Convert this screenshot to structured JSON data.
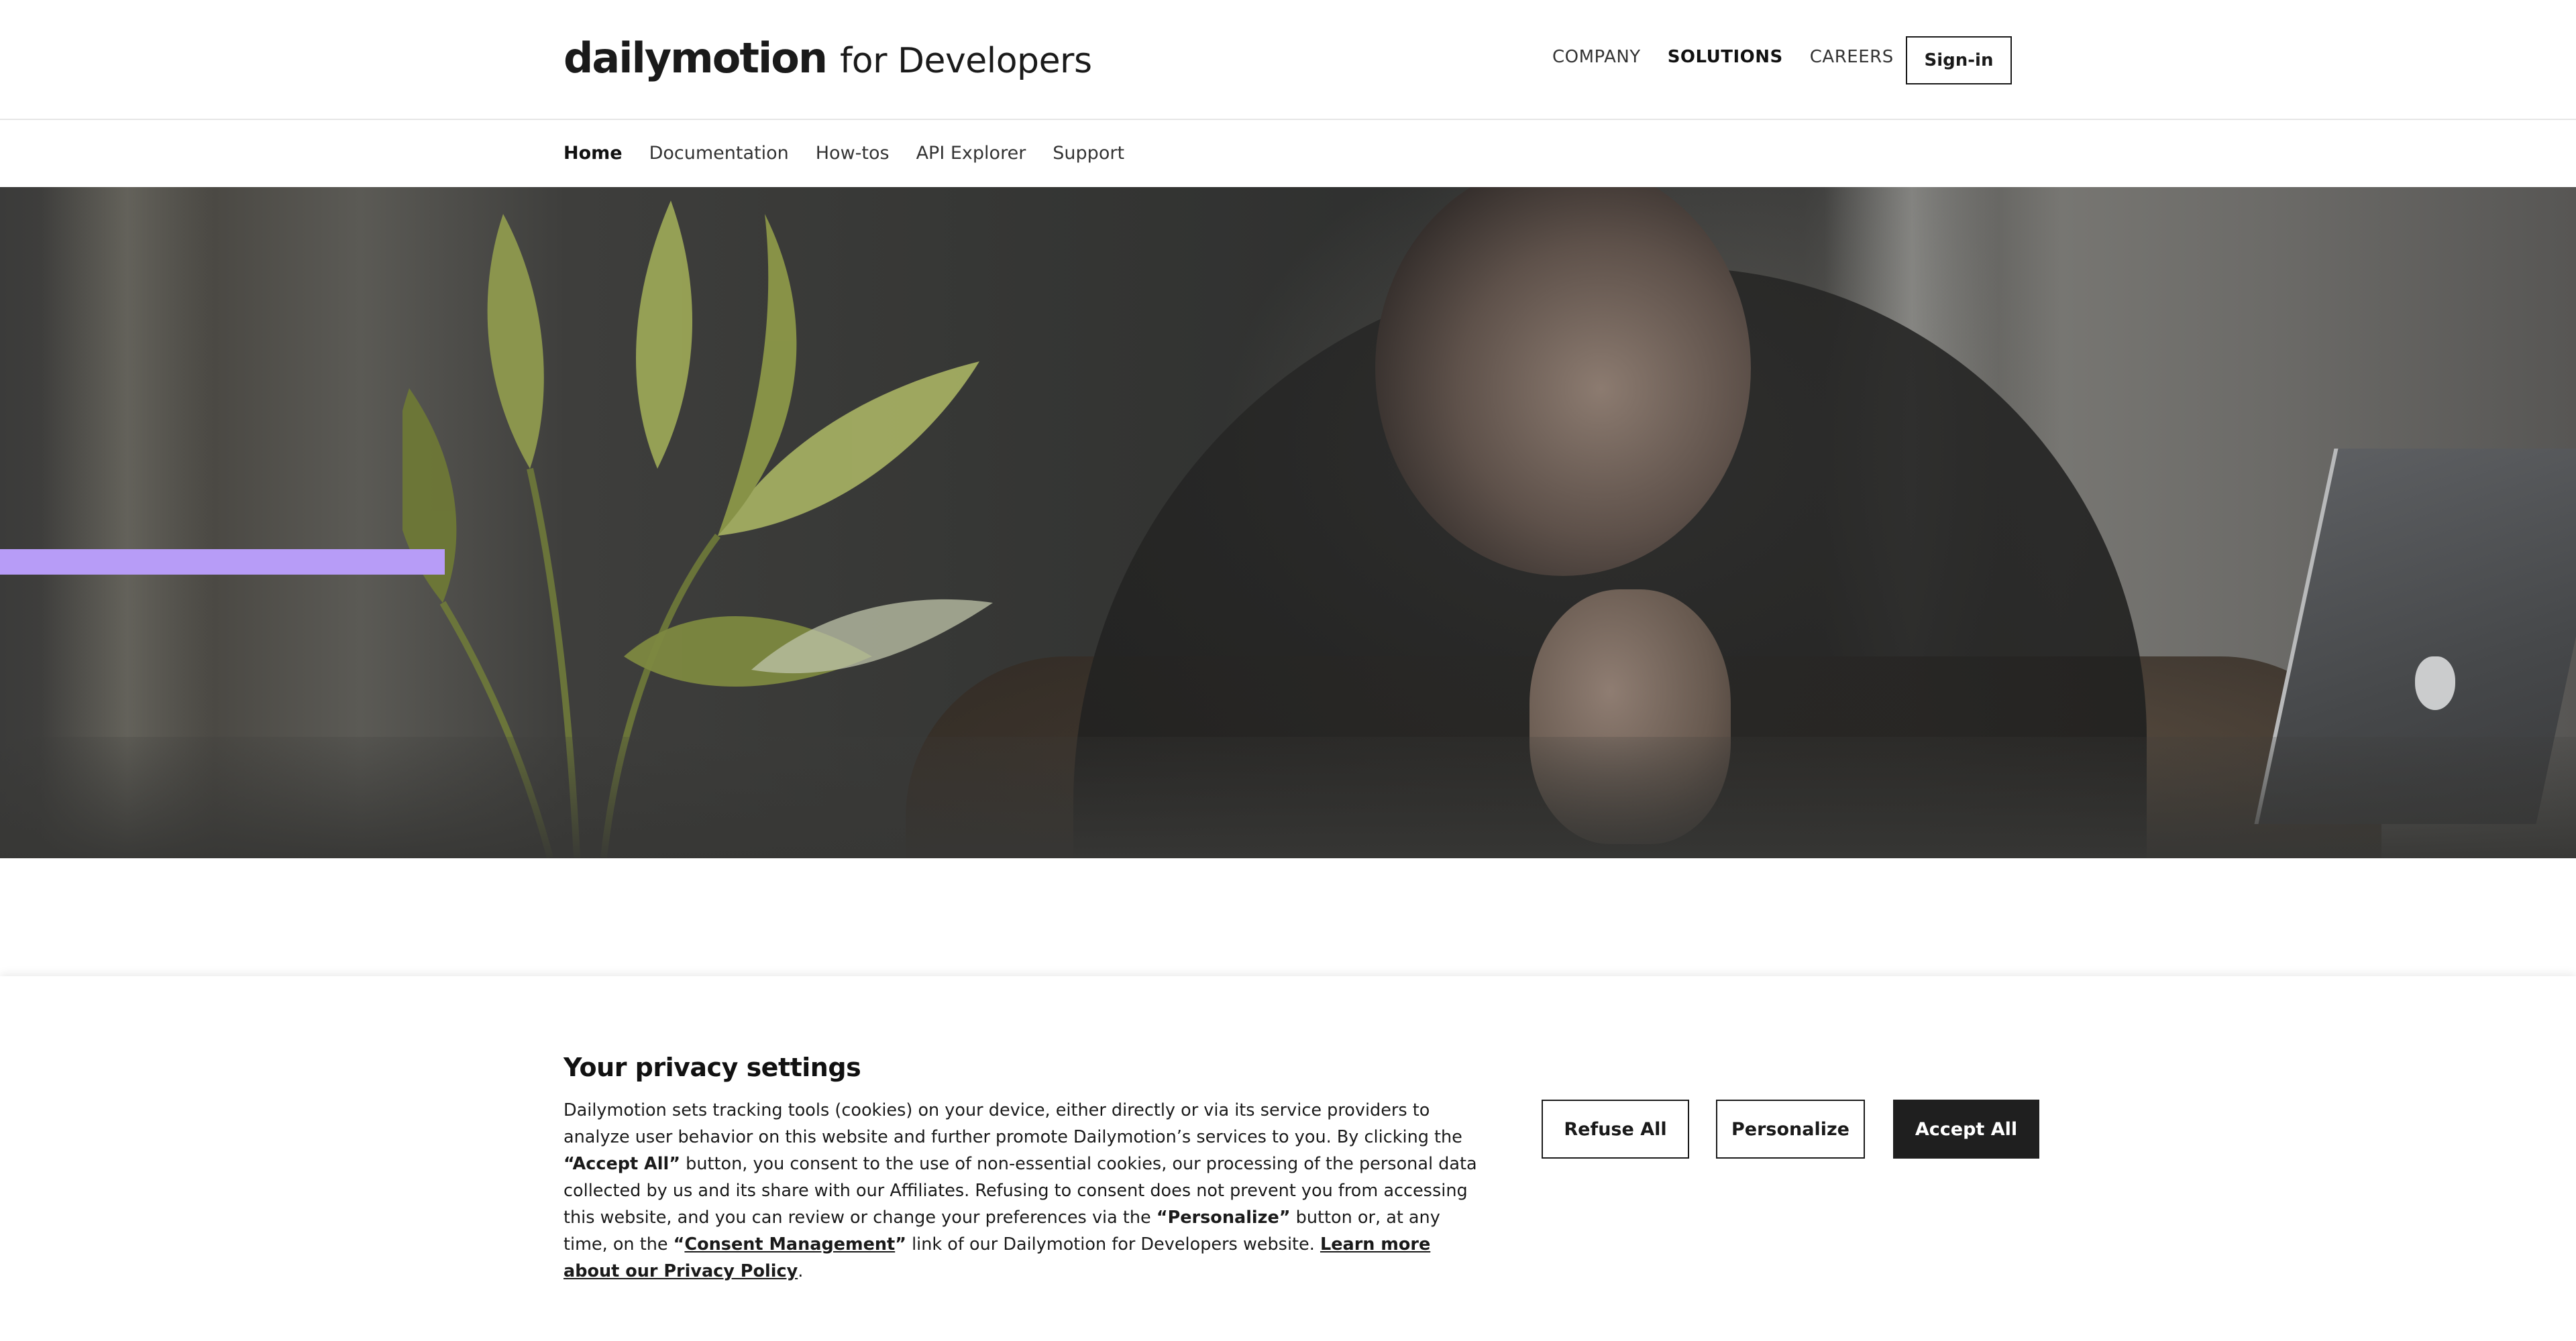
{
  "brand": {
    "logo_word": "dailymotion",
    "logo_sub": "for Developers"
  },
  "top_nav": {
    "items": [
      {
        "label": "COMPANY",
        "active": false
      },
      {
        "label": "SOLUTIONS",
        "active": true
      },
      {
        "label": "CAREERS",
        "active": false
      }
    ],
    "sign_in_label": "Sign-in"
  },
  "sub_nav": {
    "items": [
      {
        "label": "Home",
        "active": true
      },
      {
        "label": "Documentation",
        "active": false
      },
      {
        "label": "How-tos",
        "active": false
      },
      {
        "label": "API Explorer",
        "active": false
      },
      {
        "label": "Support",
        "active": false
      }
    ]
  },
  "hero": {
    "accent_color": "#b79cf7"
  },
  "cookie_banner": {
    "title": "Your privacy settings",
    "text_1": "Dailymotion sets tracking tools (cookies) on your device, either directly or via its service providers to analyze user behavior on this website and further promote Dailymotion’s services to you. By clicking the ",
    "accept_all_quoted": "“Accept All”",
    "text_2": " button, you consent to the use of non-essential cookies, our processing of the personal data collected by us and its share with our Affiliates. Refusing to consent does not prevent you from accessing this website, and you can review or change your preferences via the ",
    "personalize_quoted": "“Personalize”",
    "text_3": " button or, at any time, on the ",
    "quote_open": "“",
    "consent_link": "Consent Management",
    "quote_close": "”",
    "text_4": " link of our Dailymotion for Developers website. ",
    "privacy_link": "Learn more about our Privacy Policy",
    "text_end": ".",
    "buttons": {
      "refuse": "Refuse All",
      "personalize": "Personalize",
      "accept": "Accept All"
    }
  }
}
